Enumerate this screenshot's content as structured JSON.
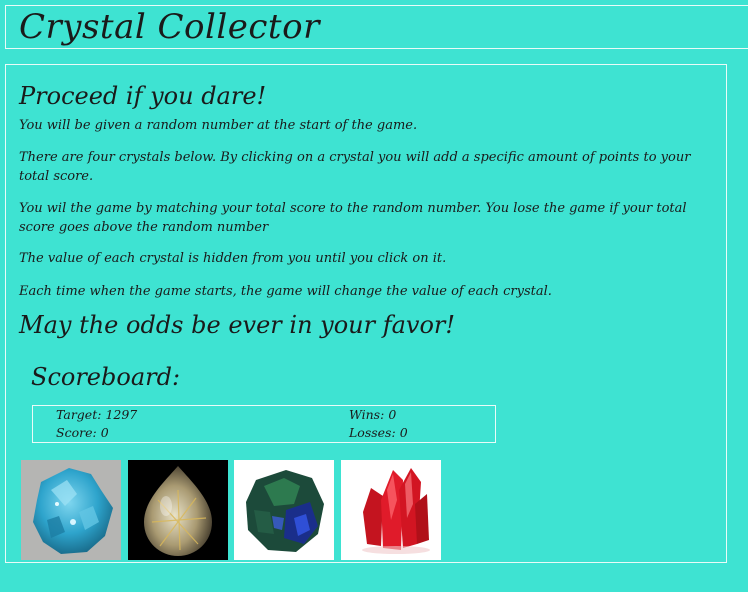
{
  "header": {
    "title": "Crystal Collector"
  },
  "intro": {
    "heading": "Proceed if you dare!",
    "paragraphs": [
      "You will be given a random number at the start of the game.",
      "There are four crystals below. By clicking on a crystal you will add a specific amount of points to your total score.",
      "You wil the game by matching your total score to the random number. You lose the game if your total score goes above the random number",
      "The value of each crystal is hidden from you until you click on it.",
      "Each time when the game starts, the game will change the value of each crystal."
    ],
    "closing": "May the odds be ever in your favor!"
  },
  "scoreboard": {
    "title": "Scoreboard:",
    "target_label": "Target:",
    "target_value": "1297",
    "score_label": "Score:",
    "score_value": "0",
    "wins_label": "Wins:",
    "wins_value": "0",
    "losses_label": "Losses:",
    "losses_value": "0"
  },
  "crystals": [
    {
      "name": "blue-crystal",
      "bg": "#b8b8b8",
      "color": "#2fa6cf"
    },
    {
      "name": "quartz-crystal",
      "bg": "#000000",
      "color": "#a99a72"
    },
    {
      "name": "azurite-crystal",
      "bg": "#ffffff",
      "color": "#1f5f3a"
    },
    {
      "name": "red-crystal",
      "bg": "#ffffff",
      "color": "#e01b2a"
    }
  ]
}
